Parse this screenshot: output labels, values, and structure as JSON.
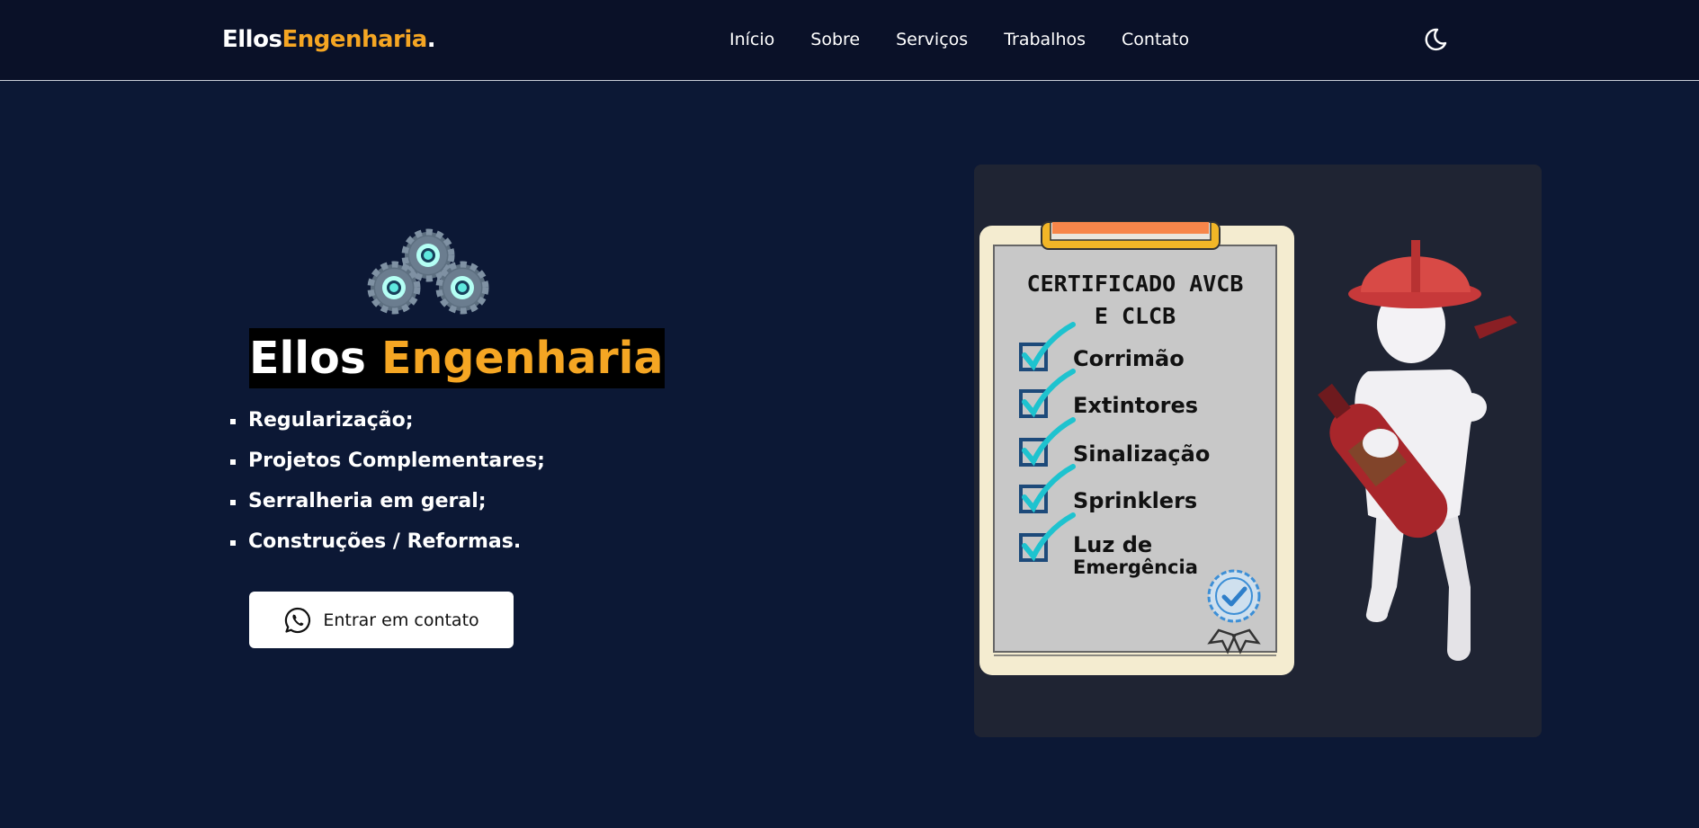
{
  "header": {
    "logo_part1": "Ellos",
    "logo_part2": "Engenharia",
    "logo_dot": ".",
    "nav": [
      "Início",
      "Sobre",
      "Serviços",
      "Trabalhos",
      "Contato"
    ],
    "theme_icon": "moon-icon"
  },
  "hero": {
    "title_part1": "Ellos",
    "title_part2": "Engenharia",
    "services": [
      "Regularização;",
      "Projetos Complementares;",
      "Serralheria em geral;",
      "Construções / Reformas."
    ],
    "cta_label": "Entrar em contato",
    "cta_icon": "whatsapp-icon",
    "decor_icon": "gears-icon"
  },
  "illustration": {
    "heading_line1": "CERTIFICADO AVCB",
    "heading_line2": "E CLCB",
    "checklist": [
      "Corrimão",
      "Extintores",
      "Sinalização",
      "Sprinklers",
      "Luz de",
      "Emergência"
    ]
  },
  "colors": {
    "background": "#0c1835",
    "header": "#0a1128",
    "accent": "#f5a623",
    "card": "#1f2433"
  }
}
